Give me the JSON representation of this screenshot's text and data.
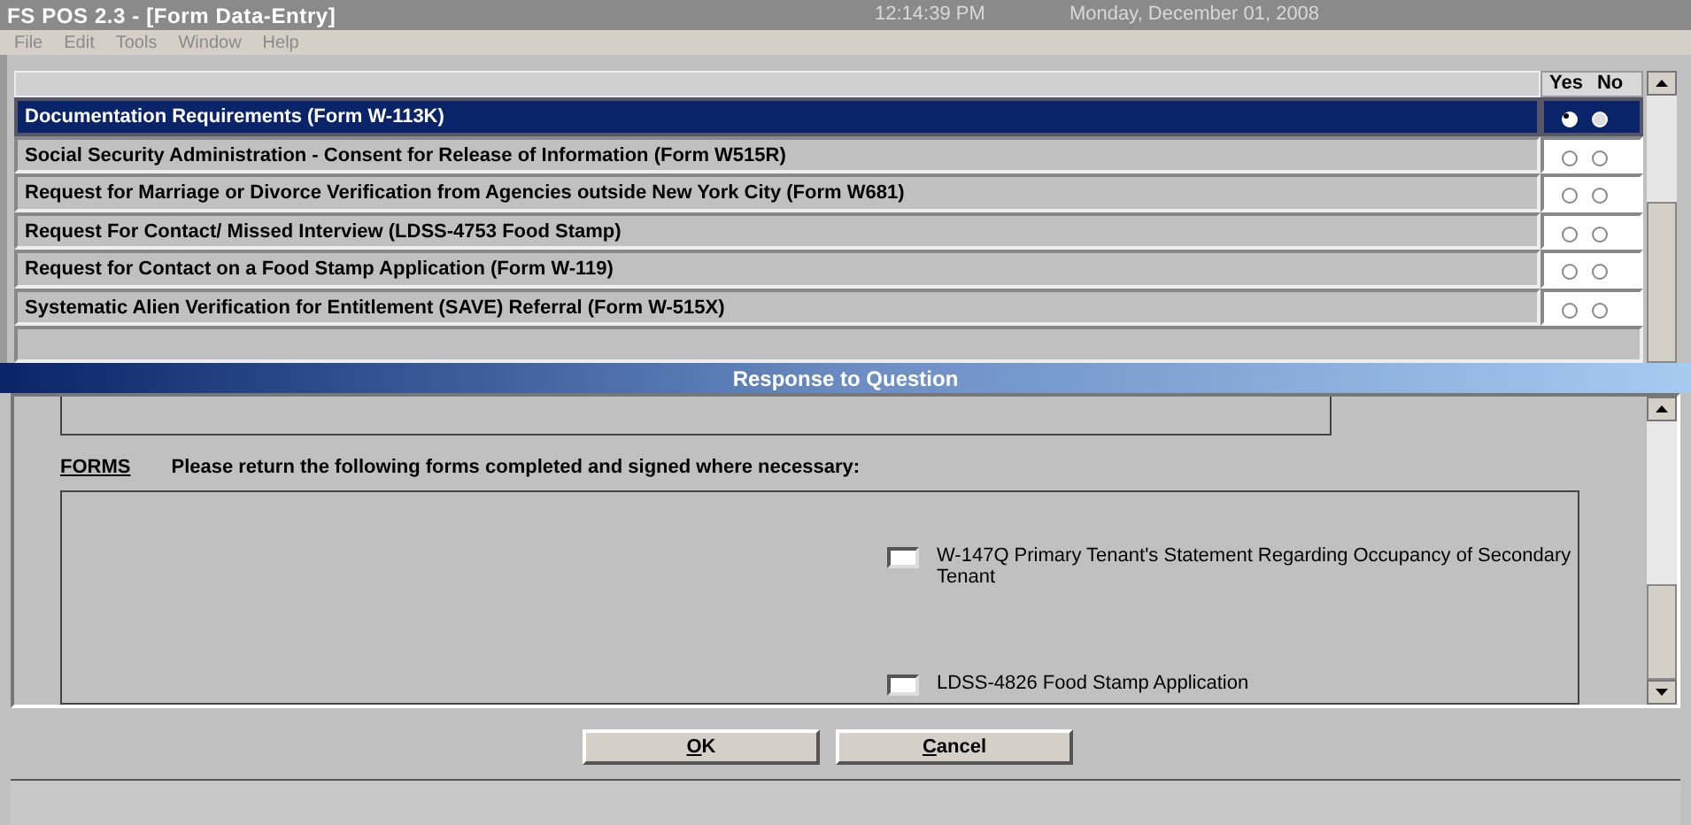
{
  "window": {
    "title": "FS POS 2.3 - [Form Data-Entry]",
    "time": "12:14:39 PM",
    "date": "Monday, December 01, 2008"
  },
  "menu": [
    "File",
    "Edit",
    "Tools",
    "Window",
    "Help"
  ],
  "table": {
    "columns": [
      "Yes",
      "No"
    ],
    "rows": [
      {
        "label": "Documentation Requirements (Form W-113K)",
        "selected": true,
        "yes": true,
        "no": false
      },
      {
        "label": "Social Security Administration - Consent for Release of Information (Form W515R)",
        "selected": false,
        "yes": false,
        "no": false
      },
      {
        "label": "Request for Marriage or Divorce Verification from Agencies outside New York City (Form W681)",
        "selected": false,
        "yes": false,
        "no": false
      },
      {
        "label": "Request For Contact/ Missed Interview (LDSS-4753 Food Stamp)",
        "selected": false,
        "yes": false,
        "no": false
      },
      {
        "label": "Request for Contact on a Food Stamp Application (Form W-119)",
        "selected": false,
        "yes": false,
        "no": false
      },
      {
        "label": "Systematic Alien Verification for Entitlement (SAVE) Referral (Form W-515X)",
        "selected": false,
        "yes": false,
        "no": false
      }
    ]
  },
  "dialog": {
    "title": "Response to Question",
    "section_label": "FORMS",
    "instruction": "Please return the following forms completed and signed where necessary:",
    "forms": [
      {
        "label": "W-147Q Primary Tenant's Statement Regarding Occupancy of Secondary Tenant",
        "checked": false
      },
      {
        "label": "LDSS-4826 Food Stamp Application",
        "checked": false
      }
    ],
    "buttons": [
      {
        "label": "OK"
      },
      {
        "label": "Cancel"
      }
    ]
  }
}
